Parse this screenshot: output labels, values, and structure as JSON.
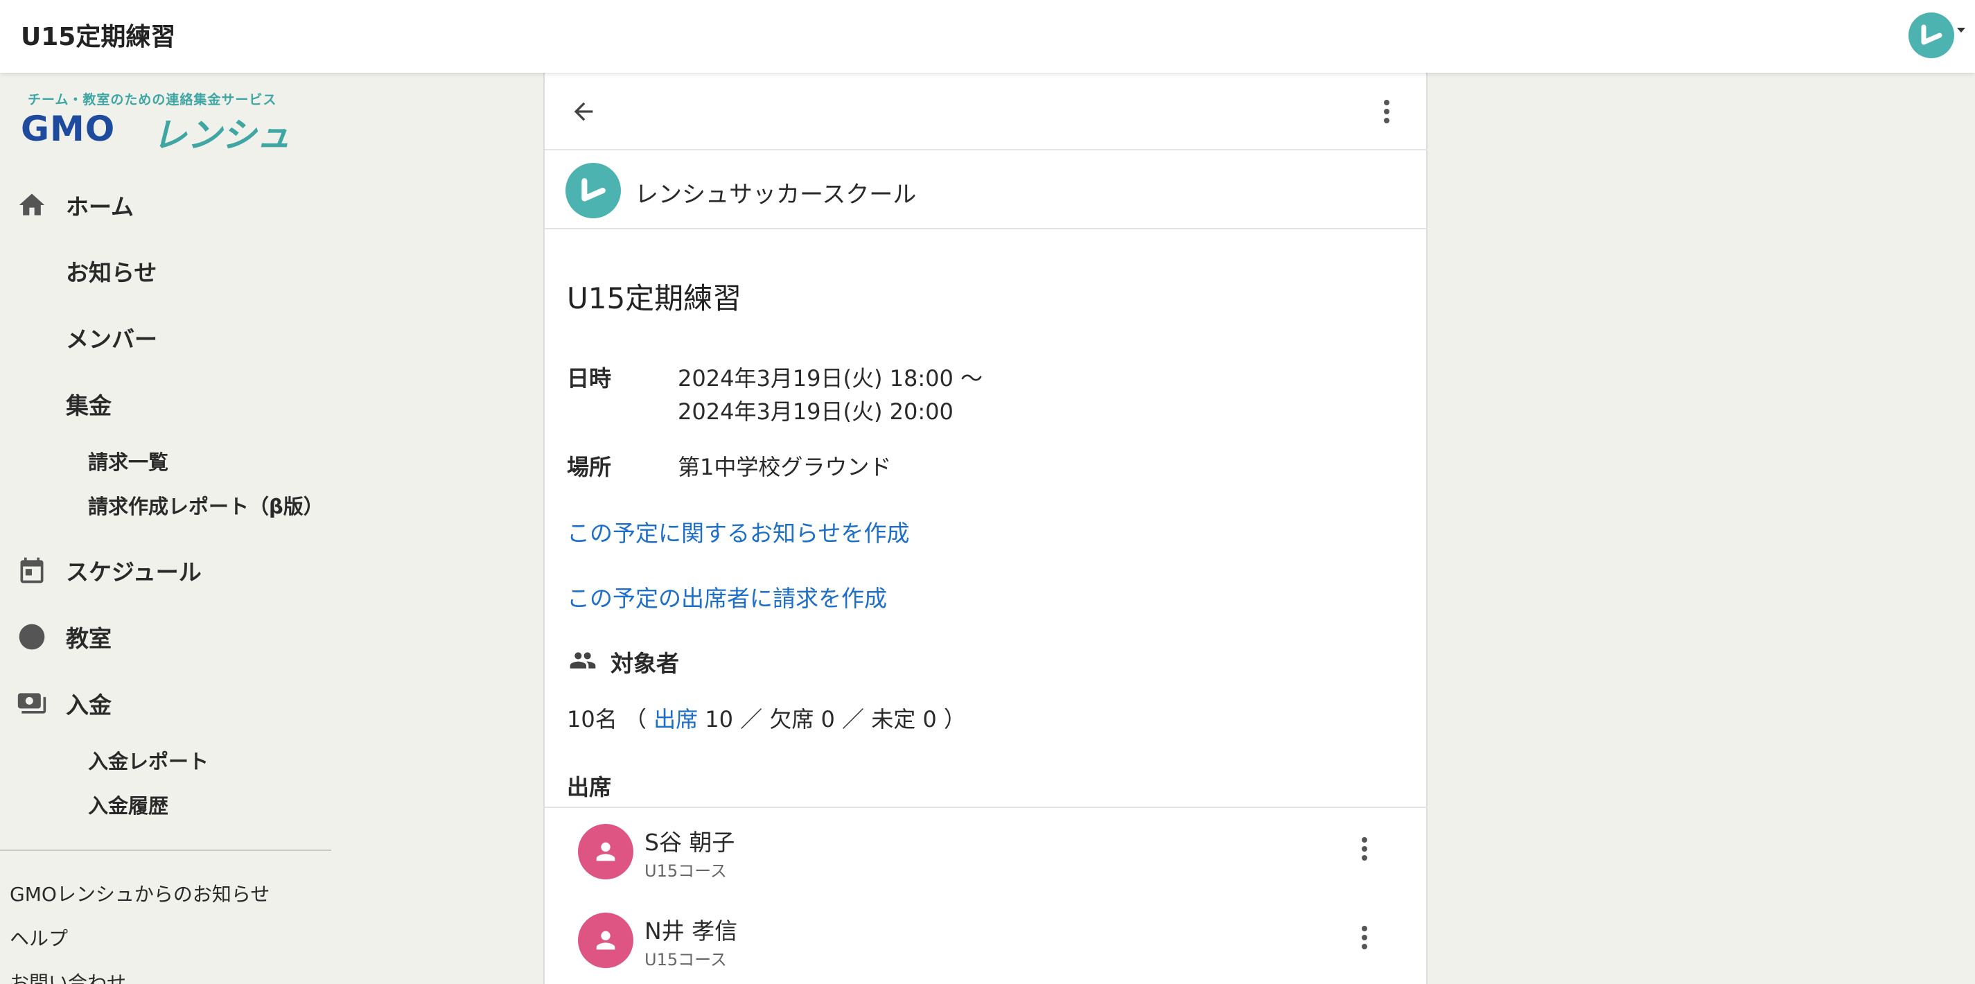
{
  "topbar": {
    "title": "U15定期練習",
    "avatar_icon": "renshu-logo-icon"
  },
  "logo": {
    "tagline": "チーム・教室のための連絡集金サービス",
    "gmo": "GMO",
    "renshu": "レンシュ"
  },
  "sidebar": {
    "home": "ホーム",
    "news": "お知らせ",
    "members": "メンバー",
    "collection": "集金",
    "invoice_list": "請求一覧",
    "invoice_report": "請求作成レポート（β版）",
    "schedule": "スケジュール",
    "classroom": "教室",
    "deposit": "入金",
    "deposit_report": "入金レポート",
    "deposit_history": "入金履歴",
    "footer_news": "GMOレンシュからのお知らせ",
    "help": "ヘルプ",
    "contact": "お問い合わせ"
  },
  "panel": {
    "org_name": "レンシュサッカースクール",
    "event_title": "U15定期練習",
    "datetime_label": "日時",
    "datetime_line1": "2024年3月19日(火) 18:00 〜",
    "datetime_line2": "2024年3月19日(火) 20:00",
    "place_label": "場所",
    "place_value": "第1中学校グラウンド",
    "link_create_news": "この予定に関するお知らせを作成",
    "link_create_invoice": "この予定の出席者に請求を作成",
    "target_title": "対象者",
    "counts_prefix": "10名 （ ",
    "counts_attend": "出席",
    "counts_rest": " 10 ／ 欠席 0 ／ 未定 0 ）",
    "attend_heading": "出席",
    "members": [
      {
        "name": "S谷 朝子",
        "course": "U15コース"
      },
      {
        "name": "N井 孝信",
        "course": "U15コース"
      }
    ]
  },
  "colors": {
    "accent_teal": "#4db3b0",
    "link_blue": "#1e6fc8",
    "member_pink": "#de5483",
    "logo_navy": "#1f4b9e"
  }
}
